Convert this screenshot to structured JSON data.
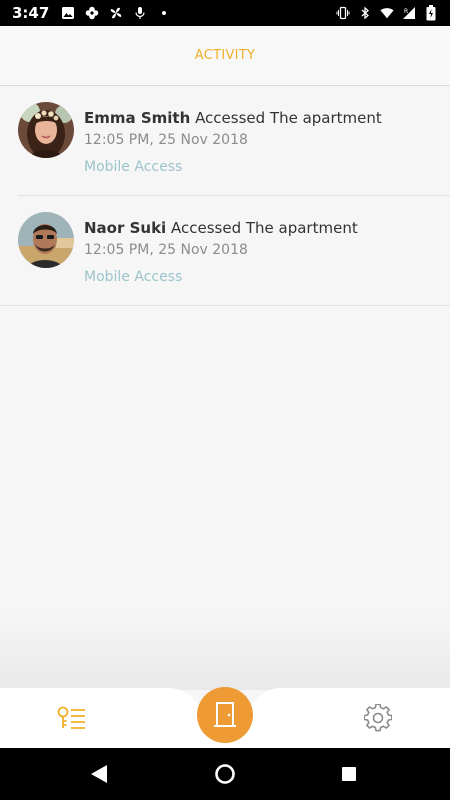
{
  "status_bar": {
    "time": "3:47",
    "left_icons": [
      "image-icon",
      "flower-icon",
      "fan-icon",
      "microphone-icon",
      "dot-icon"
    ],
    "right_icons": [
      "vibrate-icon",
      "bluetooth-icon",
      "wifi-icon",
      "signal-icon",
      "battery-icon"
    ]
  },
  "header": {
    "title": "ACTIVITY"
  },
  "activity": [
    {
      "name": "Emma Smith",
      "action": "Accessed The apartment",
      "time": "12:05 PM, 25 Nov 2018",
      "method": "Mobile Access",
      "avatar": "avatar-woman"
    },
    {
      "name": "Naor Suki",
      "action": "Accessed The apartment",
      "time": "12:05 PM, 25 Nov 2018",
      "method": "Mobile Access",
      "avatar": "avatar-man"
    }
  ],
  "bottom_nav": {
    "items": [
      "activity-key-icon",
      "door-icon",
      "gear-icon"
    ]
  },
  "colors": {
    "accent": "#f0b02b",
    "door_button": "#ee9a35",
    "method_text": "#9cc4cc"
  }
}
